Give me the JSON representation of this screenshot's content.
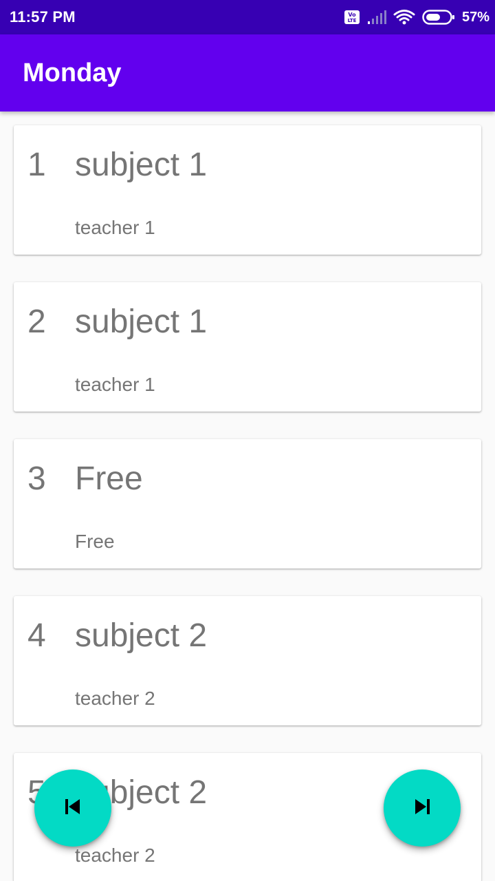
{
  "status_bar": {
    "time": "11:57 PM",
    "network_badge": "Vo LTE",
    "battery_percent": "57%",
    "icons": [
      "volte-icon",
      "signal-icon",
      "wifi-icon",
      "battery-icon"
    ]
  },
  "app_bar": {
    "title": "Monday"
  },
  "periods": [
    {
      "number": "1",
      "subject": "subject 1",
      "teacher": "teacher 1"
    },
    {
      "number": "2",
      "subject": "subject 1",
      "teacher": "teacher 1"
    },
    {
      "number": "3",
      "subject": "Free",
      "teacher": "Free"
    },
    {
      "number": "4",
      "subject": "subject 2",
      "teacher": "teacher 2"
    },
    {
      "number": "5",
      "subject": "subject 2",
      "teacher": "teacher 2"
    }
  ],
  "fab": {
    "previous_icon": "skip-previous-icon",
    "next_icon": "skip-next-icon"
  },
  "colors": {
    "status_bar": "#3700b3",
    "app_bar": "#6200ee",
    "fab": "#03dac5",
    "card_text": "#757575"
  }
}
